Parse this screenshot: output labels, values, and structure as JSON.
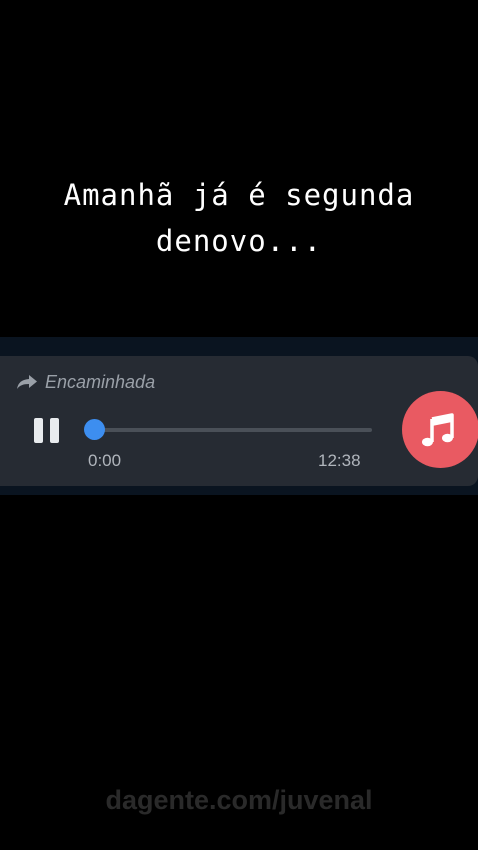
{
  "caption": {
    "line1": "Amanhã já é segunda",
    "line2": "denovo..."
  },
  "audio_message": {
    "forwarded_label": "Encaminhada",
    "forwarded_icon": "forward-arrow-icon",
    "play_state": "playing",
    "control_icon": "pause-icon",
    "current_time": "0:00",
    "duration": "12:38",
    "progress": 0.0,
    "badge_icon": "music-note-icon",
    "colors": {
      "bubble": "#262b33",
      "accent": "#3d8ef0",
      "badge": "#e95a62"
    }
  },
  "watermark": "dagente.com/juvenal"
}
